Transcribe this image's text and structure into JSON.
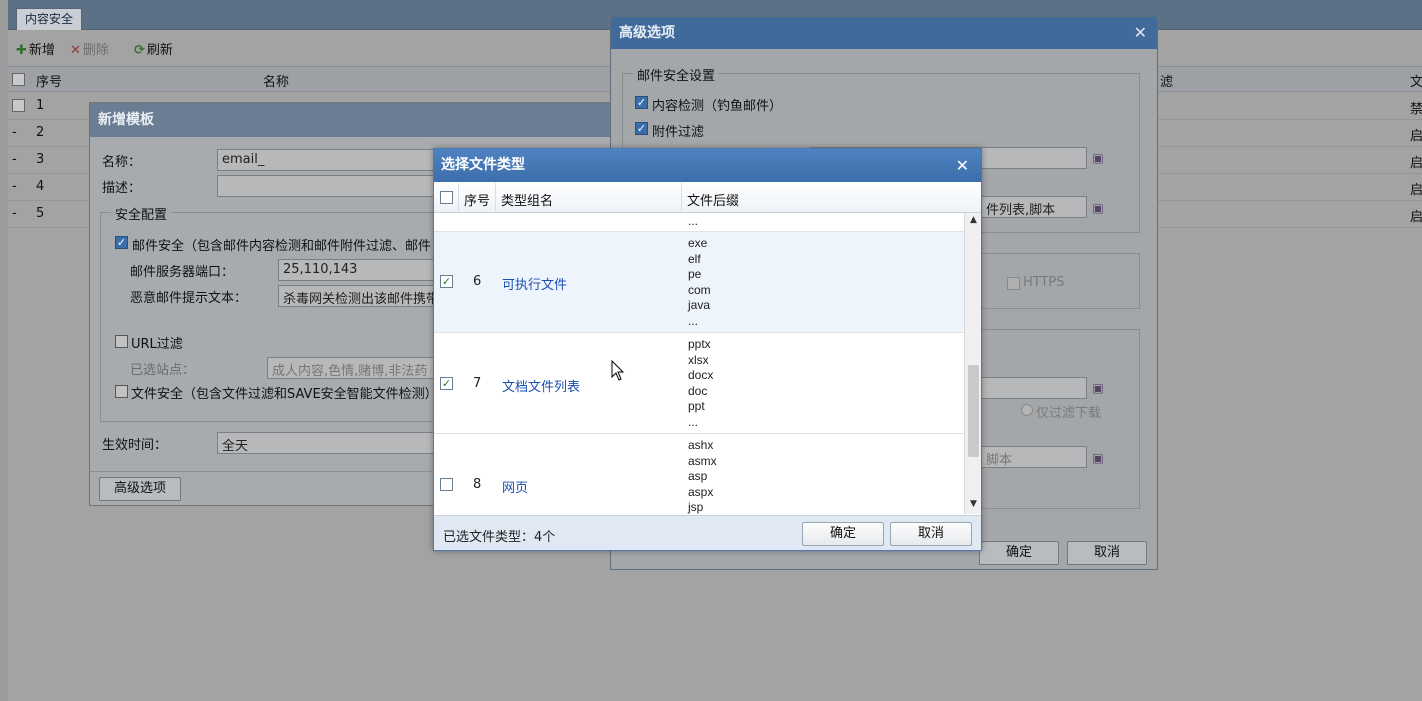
{
  "app": {
    "tab": "内容安全",
    "toolbar": {
      "add": "新增",
      "delete": "删除",
      "refresh": "刷新"
    },
    "grid": {
      "col_seq": "序号",
      "col_name": "名称",
      "col_filter": "滤",
      "col_file": "文",
      "rows": [
        {
          "seq": "1",
          "name": "",
          "status": "禁"
        },
        {
          "seq": "2",
          "status": "启"
        },
        {
          "seq": "3",
          "status": "启"
        },
        {
          "seq": "4",
          "status": "启"
        },
        {
          "seq": "5",
          "status": "启"
        }
      ]
    }
  },
  "template_dialog": {
    "title": "新增模板",
    "name_label": "名称：",
    "name_value": "email_",
    "desc_label": "描述：",
    "security_legend": "安全配置",
    "mail_security": "邮件安全（包含邮件内容检测和邮件附件过滤、邮件",
    "mail_port_label": "邮件服务器端口：",
    "mail_port_value": "25,110,143",
    "mail_alert_label": "恶意邮件提示文本：",
    "mail_alert_value": "杀毒网关检测出该邮件携带",
    "url_filter": "URL过滤",
    "selected_sites_label": "已选站点：",
    "selected_sites_value": "成人内容,色情,赌博,非法药",
    "file_security": "文件安全（包含文件过滤和SAVE安全智能文件检测）",
    "effective_label": "生效时间：",
    "effective_value": "全天",
    "advanced_button": "高级选项"
  },
  "advanced_dialog": {
    "title": "高级选项",
    "mail_legend": "邮件安全设置",
    "content_check": "内容检测（钓鱼邮件）",
    "attach_filter": "附件过滤",
    "ext_value": "件列表,脚本",
    "https": "HTTPS",
    "filter_download": "仅过滤下载",
    "script_value": "脚本",
    "ok": "确定",
    "cancel": "取消"
  },
  "filetype_dialog": {
    "title": "选择文件类型",
    "col_seq": "序号",
    "col_group": "类型组名",
    "col_ext": "文件后缀",
    "rows": [
      {
        "seq": "",
        "name": "",
        "checked": false,
        "exts": [
          "..."
        ]
      },
      {
        "seq": "6",
        "name": "可执行文件",
        "checked": true,
        "exts": [
          "exe",
          "elf",
          "pe",
          "com",
          "java",
          "..."
        ]
      },
      {
        "seq": "7",
        "name": "文档文件列表",
        "checked": true,
        "exts": [
          "pptx",
          "xlsx",
          "docx",
          "doc",
          "ppt",
          "..."
        ]
      },
      {
        "seq": "8",
        "name": "网页",
        "checked": false,
        "exts": [
          "ashx",
          "asmx",
          "asp",
          "aspx",
          "jsp"
        ]
      }
    ],
    "selected_count": "已选文件类型：4个",
    "ok": "确定",
    "cancel": "取消"
  },
  "colors": {
    "dialog_blue": "#3c6eab",
    "link": "#1a4fb4",
    "check_green": "#2b7a2b"
  }
}
